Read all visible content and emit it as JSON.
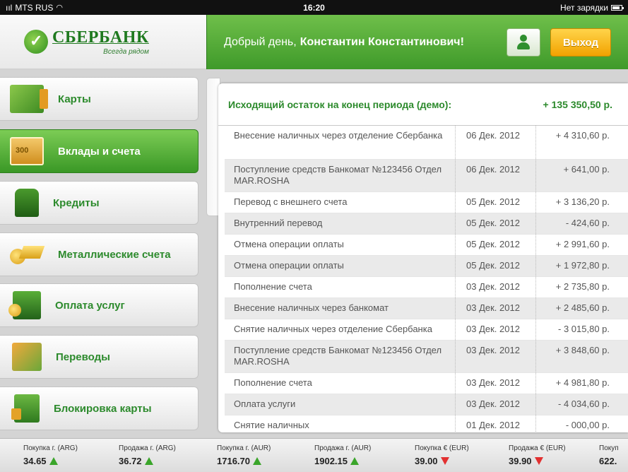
{
  "status_bar": {
    "carrier": "MTS RUS",
    "time": "16:20",
    "battery_text": "Нет зарядки"
  },
  "header": {
    "logo_name": "СБЕРБАНК",
    "logo_tagline": "Всегда рядом",
    "greeting": "Добрый день,",
    "user_name": "Константин Константинович!",
    "exit_label": "Выход"
  },
  "sidebar": {
    "items": [
      {
        "label": "Карты",
        "icon": "cards-icon",
        "active": false
      },
      {
        "label": "Вклады и счета",
        "icon": "money-icon",
        "active": true
      },
      {
        "label": "Кредиты",
        "icon": "purse-icon",
        "active": false
      },
      {
        "label": "Металлические счета",
        "icon": "gold-icon",
        "active": false
      },
      {
        "label": "Оплата услуг",
        "icon": "briefcase-icon",
        "active": false
      },
      {
        "label": "Переводы",
        "icon": "transfer-icon",
        "active": false
      },
      {
        "label": "Блокировка карты",
        "icon": "lock-icon",
        "active": false
      }
    ]
  },
  "summary": {
    "label": "Исходящий остаток на конец периода (демо):",
    "amount": "+ 135 350,50 р."
  },
  "transactions": [
    {
      "description": "Внесение наличных через отделение Сбербанка",
      "date": "06 Дек. 2012",
      "amount": "+ 4 310,60 р."
    },
    {
      "description": "Поступление средств Банкомат №123456 Отдел MAR.ROSHA",
      "date": "06 Дек. 2012",
      "amount": "+ 641,00 р."
    },
    {
      "description": "Перевод с внешнего счета",
      "date": "05 Дек. 2012",
      "amount": "+ 3 136,20 р."
    },
    {
      "description": "Внутренний перевод",
      "date": "05 Дек. 2012",
      "amount": "- 424,60 р."
    },
    {
      "description": "Отмена операции оплаты",
      "date": "05 Дек. 2012",
      "amount": "+ 2 991,60 р."
    },
    {
      "description": "Отмена операции оплаты",
      "date": "05 Дек. 2012",
      "amount": "+ 1 972,80 р."
    },
    {
      "description": "Пополнение счета",
      "date": "03 Дек. 2012",
      "amount": "+ 2 735,80 р."
    },
    {
      "description": "Внесение наличных через банкомат",
      "date": "03 Дек. 2012",
      "amount": "+ 2 485,60 р."
    },
    {
      "description": "Снятие наличных через отделение Сбербанка",
      "date": "03 Дек. 2012",
      "amount": "- 3 015,80 р."
    },
    {
      "description": "Поступление средств Банкомат №123456 Отдел MAR.ROSHA",
      "date": "03 Дек. 2012",
      "amount": "+ 3 848,60 р."
    },
    {
      "description": "Пополнение счета",
      "date": "03 Дек. 2012",
      "amount": "+ 4 981,80 р."
    },
    {
      "description": "Оплата услуги",
      "date": "03 Дек. 2012",
      "amount": "- 4 034,60 р."
    },
    {
      "description": "Снятие наличных",
      "date": "01 Дек. 2012",
      "amount": "- 000,00 р."
    }
  ],
  "ticker": [
    {
      "label": "Покупка г. (ARG)",
      "value": "34.65",
      "trend": "up"
    },
    {
      "label": "Продажа г. (ARG)",
      "value": "36.72",
      "trend": "up"
    },
    {
      "label": "Покупка г. (AUR)",
      "value": "1716.70",
      "trend": "up"
    },
    {
      "label": "Продажа г. (AUR)",
      "value": "1902.15",
      "trend": "up"
    },
    {
      "label": "Покупка € (EUR)",
      "value": "39.00",
      "trend": "down"
    },
    {
      "label": "Продажа € (EUR)",
      "value": "39.90",
      "trend": "down"
    },
    {
      "label": "Покуп",
      "value": "622.",
      "trend": "none"
    }
  ],
  "colors": {
    "brand_green": "#2c8a2c",
    "header_green": "#4fa934",
    "exit_yellow": "#f5b800",
    "up_green": "#3aa52a",
    "down_red": "#e23030"
  }
}
